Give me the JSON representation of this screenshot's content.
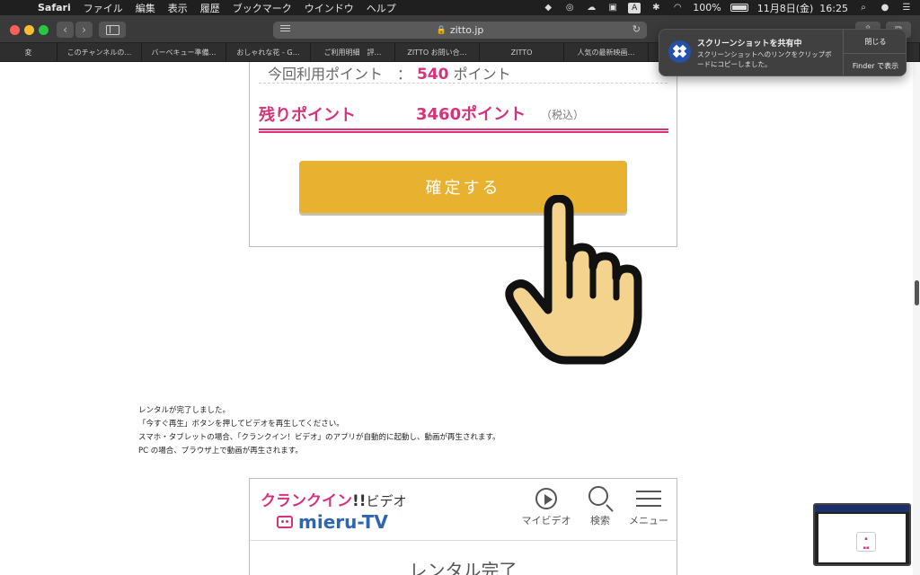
{
  "menubar": {
    "app": "Safari",
    "items": [
      "ファイル",
      "編集",
      "表示",
      "履歴",
      "ブックマーク",
      "ウインドウ",
      "ヘルプ"
    ],
    "battery": "100%",
    "datetime": "11月8日(金)  16:25",
    "input_mode": "A"
  },
  "toolbar": {
    "url": "zitto.jp"
  },
  "tabs": [
    "変",
    "このチャンネルの…",
    "バーベキュー準備…",
    "おしゃれな花 - G…",
    "ご利用明細　評…",
    "ZITTO お問い合…",
    "ZITTO",
    "人気の最新映画…",
    ""
  ],
  "points": {
    "use_label": "今回利用ポイント　：",
    "use_value": "540",
    "use_unit": "ポイント",
    "remain_label": "残りポイント",
    "remain_value": "3460ポイント",
    "remain_tax": "（税込）",
    "confirm_button": "確定する"
  },
  "message": {
    "lines": [
      "レンタルが完了しました。",
      "「今すぐ再生」ボタンを押してビデオを再生してください。",
      "スマホ・タブレットの場合、「クランクイン！ビデオ」のアプリが自動的に起動し、動画が再生されます。",
      "PC の場合、ブラウザ上で動画が再生されます。"
    ]
  },
  "embedded": {
    "brand_main": "クランクイン",
    "brand_bang": "!!",
    "brand_video": "ビデオ",
    "brand_sub": "mieru-TV",
    "nav_myvideo": "マイビデオ",
    "nav_search": "検索",
    "nav_menu": "メニュー",
    "rental_done": "レンタル完了"
  },
  "notification": {
    "title": "スクリーンショットを共有中",
    "body": "スクリーンショットへのリンクをクリップボードにコピーしました。",
    "close": "閉じる",
    "finder": "Finder で表示"
  },
  "colors": {
    "accent_pink": "#d6337a",
    "button_yellow": "#e8b12f",
    "brand_blue": "#2f66b0"
  }
}
